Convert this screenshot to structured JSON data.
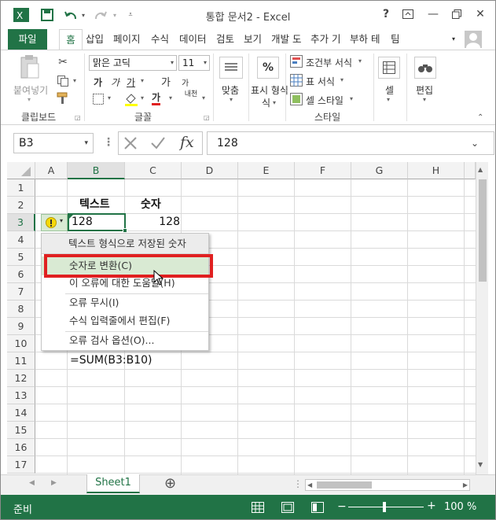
{
  "window": {
    "title": "통합 문서2 - Excel",
    "help": "?",
    "minimize": "—",
    "close": "✕"
  },
  "tabs": [
    "파일",
    "홈",
    "삽입",
    "페이지",
    "수식",
    "데이터",
    "검토",
    "보기",
    "개발 도",
    "추가 기",
    "부하 테",
    "팀"
  ],
  "ribbon": {
    "clipboard": {
      "paste": "붙여넣기",
      "label": "클립보드"
    },
    "font": {
      "name": "맑은 고딕",
      "size": "11",
      "bold": "가",
      "italic": "가",
      "underline": "가",
      "grow": "가",
      "shrink": "가",
      "color_a": "가",
      "phonetic": "내천",
      "label": "글꼴"
    },
    "align": {
      "label": "맞춤"
    },
    "number": {
      "label": "표시 형식",
      "label2": "식",
      "percent": "%"
    },
    "styles": {
      "conditional": "조건부 서식",
      "table": "표 서식",
      "cell": "셀 스타일",
      "label": "스타일"
    },
    "cells": {
      "label": "셀"
    },
    "editing": {
      "label": "편집"
    }
  },
  "formula_bar": {
    "namebox": "B3",
    "fx": "fx",
    "value": "128"
  },
  "grid": {
    "columns": [
      "A",
      "B",
      "C",
      "D",
      "E",
      "F",
      "G",
      "H"
    ],
    "rows": [
      "1",
      "2",
      "3",
      "4",
      "5",
      "6",
      "7",
      "8",
      "9",
      "10",
      "11",
      "12",
      "13",
      "14",
      "15",
      "16",
      "17"
    ],
    "cells": {
      "B2": "텍스트",
      "C2": "숫자",
      "B3": "128",
      "C3": "128",
      "B11": "=SUM(B3:B10)"
    }
  },
  "error_menu": {
    "header": "텍스트 형식으로 저장된 숫자",
    "items": [
      "숫자로 변환(C)",
      "이 오류에 대한 도움말(H)",
      "오류 무시(I)",
      "수식 입력줄에서 편집(F)",
      "오류 검사 옵션(O)..."
    ]
  },
  "sheet": {
    "tab": "Sheet1",
    "add": "⊕"
  },
  "status": {
    "mode": "준비",
    "zoom": "100 %"
  },
  "colors": {
    "accent": "#217346",
    "highlight": "#d9ead3",
    "callout": "#e02020"
  }
}
